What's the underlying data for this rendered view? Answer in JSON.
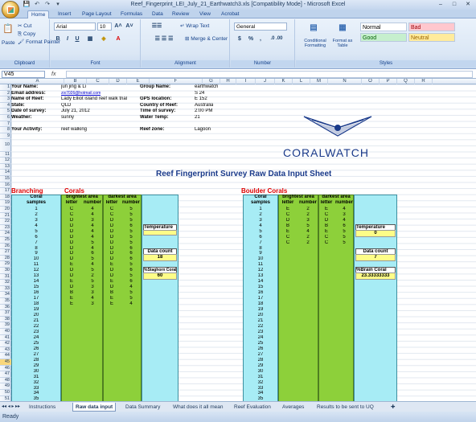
{
  "title": {
    "text": "Reef_Fingerprint_LEI_July_21_Earthwatch3.xls [Compatibility Mode] - Microsoft Excel",
    "qat": [
      "💾",
      "↶",
      "↷",
      "▾"
    ],
    "controls": [
      "–",
      "□",
      "✕"
    ]
  },
  "tabs": [
    "Home",
    "Insert",
    "Page Layout",
    "Formulas",
    "Data",
    "Review",
    "View",
    "Acrobat"
  ],
  "ribbon": {
    "clipboard": {
      "cut": "Cut",
      "copy": "Copy",
      "paste": "Paste",
      "painter": "Format Painter",
      "label": "Clipboard"
    },
    "font": {
      "name": "Arial",
      "size": "10",
      "label": "Font",
      "bold": "B",
      "italic": "I",
      "underline": "U",
      "grow": "A˄",
      "shrink": "A˅"
    },
    "alignment": {
      "wrap": "Wrap Text",
      "merge": "Merge & Center",
      "label": "Alignment"
    },
    "number": {
      "format": "General",
      "currency": "$",
      "percent": "%",
      "comma": ",",
      "label": "Number"
    },
    "styles": {
      "conditional": "Conditional Formatting",
      "as_table": "Format as Table",
      "normal": "Normal",
      "bad": "Bad",
      "good": "Good",
      "neutral": "Neutral",
      "label": "Styles"
    }
  },
  "formula_bar": {
    "name_box": "V45",
    "fx": "fx",
    "value": ""
  },
  "columns": [
    "A",
    "B",
    "C",
    "D",
    "E",
    "F",
    "G",
    "H",
    "I",
    "J",
    "K",
    "L",
    "M",
    "N",
    "O",
    "P",
    "Q",
    "R"
  ],
  "info": {
    "your_name_label": "Your Name:",
    "your_name": "jun jing & Li",
    "email_label": "Email address:",
    "email": "zix7026@hotmail.com",
    "reef_label": "Name of Reef:",
    "reef": "Lady Elliot island reef walk trial",
    "state_label": "State:",
    "state": "QLD",
    "date_label": "Date of survey:",
    "date": "July 21, 2012",
    "weather_label": "Weather:",
    "weather": "sunny",
    "activity_label": "Your Activity:",
    "activity": "reef walking",
    "group_label": "Group Name:",
    "group": "earthwatch",
    "gps_label": "GPS location:",
    "gps_s": "S 24",
    "gps_e": "E 152",
    "country_label": "Country of Reef:",
    "country": "Australia",
    "time_label": "Time of survey:",
    "time": "2:00 PM",
    "water_label": "Water Temp:",
    "water": "21",
    "zone_label": "Reef zone:",
    "zone": "Lagoon"
  },
  "logo": "CORALWATCH",
  "sheet_title": "Reef Fingerprint Survey Raw Data Input Sheet",
  "branching": {
    "title1": "Branching",
    "title2": "Corals",
    "h_coral": "Coral",
    "h_samples": "samples",
    "h_brightest": "brightest area",
    "h_darkest": "darkest area",
    "h_letter": "letter",
    "h_number": "number",
    "temperature": "Temperature",
    "data_count_label": "Data count",
    "data_count": "18",
    "percent_label": "%Staghorn Coral",
    "percent": "60",
    "rows": [
      [
        "1",
        "C",
        "4",
        "C",
        "5"
      ],
      [
        "2",
        "C",
        "4",
        "C",
        "5"
      ],
      [
        "3",
        "D",
        "3",
        "D",
        "5"
      ],
      [
        "4",
        "D",
        "4",
        "D",
        "6"
      ],
      [
        "5",
        "D",
        "4",
        "D",
        "5"
      ],
      [
        "6",
        "D",
        "4",
        "D",
        "5"
      ],
      [
        "7",
        "D",
        "5",
        "D",
        "5"
      ],
      [
        "8",
        "D",
        "4",
        "D",
        "6"
      ],
      [
        "9",
        "D",
        "6",
        "D",
        "6"
      ],
      [
        "10",
        "D",
        "5",
        "D",
        "6"
      ],
      [
        "11",
        "E",
        "4",
        "E",
        "5"
      ],
      [
        "12",
        "D",
        "5",
        "D",
        "6"
      ],
      [
        "13",
        "D",
        "2",
        "D",
        "5"
      ],
      [
        "14",
        "E",
        "5",
        "E",
        "6"
      ],
      [
        "15",
        "D",
        "3",
        "D",
        "4"
      ],
      [
        "16",
        "B",
        "3",
        "B",
        "5"
      ],
      [
        "17",
        "E",
        "4",
        "E",
        "5"
      ],
      [
        "18",
        "E",
        "3",
        "E",
        "4"
      ]
    ]
  },
  "boulder": {
    "title": "Boulder Corals",
    "h_coral": "Coral",
    "h_samples": "samples",
    "h_brightest": "brightest area",
    "h_darkest": "darkest area",
    "h_letter": "letter",
    "h_number": "number",
    "temperature": "Temperature",
    "temperature_value": "0",
    "data_count_label": "Data count",
    "data_count": "7",
    "percent_label": "%Brain Coral",
    "percent": "23.33333333",
    "rows": [
      [
        "1",
        "E",
        "2",
        "E",
        "4"
      ],
      [
        "2",
        "C",
        "2",
        "C",
        "3"
      ],
      [
        "3",
        "D",
        "3",
        "D",
        "4"
      ],
      [
        "4",
        "B",
        "5",
        "B",
        "6"
      ],
      [
        "5",
        "E",
        "4",
        "E",
        "5"
      ],
      [
        "6",
        "C",
        "2",
        "C",
        "5"
      ],
      [
        "7",
        "C",
        "2",
        "C",
        "5"
      ]
    ]
  },
  "sample_numbers": [
    "1",
    "2",
    "3",
    "4",
    "5",
    "6",
    "7",
    "8",
    "9",
    "10",
    "11",
    "12",
    "13",
    "14",
    "15",
    "16",
    "17",
    "18",
    "19",
    "20",
    "21",
    "22",
    "23",
    "24",
    "25",
    "26",
    "27",
    "28",
    "29",
    "30",
    "31",
    "32",
    "33",
    "34",
    "35",
    "36",
    "37"
  ],
  "row_numbers": [
    "1",
    "2",
    "3",
    "4",
    "5",
    "6",
    "7",
    "8",
    "9",
    "10",
    "11",
    "12",
    "13",
    "14",
    "15",
    "16",
    "17",
    "18",
    "19",
    "20",
    "21",
    "22",
    "23",
    "24",
    "25",
    "26",
    "27",
    "28",
    "29",
    "30",
    "31",
    "32",
    "33",
    "34",
    "35",
    "36",
    "37",
    "38",
    "39",
    "40",
    "41",
    "42",
    "43",
    "44",
    "45",
    "46",
    "47",
    "48",
    "49",
    "50",
    "51"
  ],
  "sheet_tabs": [
    "Instructions",
    "Raw data input",
    "Data Summary",
    "What does it all mean",
    "Reef Evaluation",
    "Averages",
    "Results to be sent to UQ"
  ],
  "status": "Ready"
}
